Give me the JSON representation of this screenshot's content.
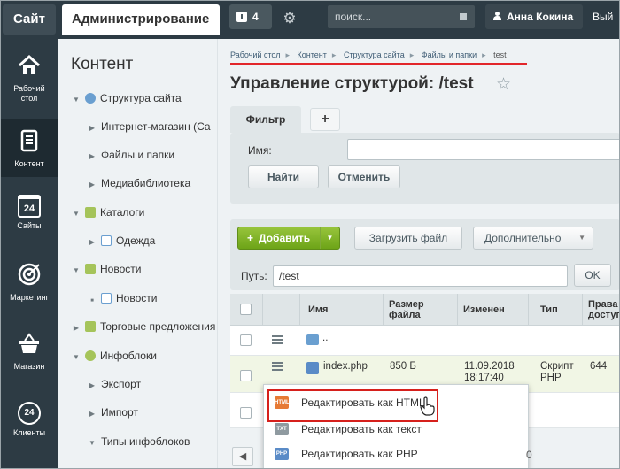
{
  "topbar": {
    "site_label": "Сайт",
    "admin_label": "Администрирование",
    "notif_count": "4",
    "search_placeholder": "поиск...",
    "user_name": "Анна Кокина",
    "exit_label": "Вый"
  },
  "leftnav": {
    "items": [
      {
        "label1": "Рабочий",
        "label2": "стол"
      },
      {
        "label1": "Контент",
        "label2": ""
      },
      {
        "label1": "Сайты",
        "label2": ""
      },
      {
        "label1": "Маркетинг",
        "label2": ""
      },
      {
        "label1": "Магазин",
        "label2": ""
      },
      {
        "label1": "Клиенты",
        "label2": ""
      }
    ],
    "calendar_number": "24",
    "clients_number": "24"
  },
  "tree": {
    "title": "Контент",
    "items": [
      {
        "label": "Структура сайта",
        "arrow": "▼"
      },
      {
        "label": "Интернет-магазин (Са",
        "arrow": "▶"
      },
      {
        "label": "Файлы и папки",
        "arrow": "▶"
      },
      {
        "label": "Медиабиблиотека",
        "arrow": "▶"
      },
      {
        "label": "Каталоги",
        "arrow": "▼"
      },
      {
        "label": "Одежда",
        "arrow": "▶"
      },
      {
        "label": "Новости",
        "arrow": "▼"
      },
      {
        "label": "Новости",
        "arrow": "■"
      },
      {
        "label": "Торговые предложения",
        "arrow": "▶"
      },
      {
        "label": "Инфоблоки",
        "arrow": "▼"
      },
      {
        "label": "Экспорт",
        "arrow": "▶"
      },
      {
        "label": "Импорт",
        "arrow": "▶"
      },
      {
        "label": "Типы инфоблоков",
        "arrow": "▼"
      }
    ]
  },
  "breadcrumb": {
    "items": [
      "Рабочий стол",
      "Контент",
      "Структура сайта",
      "Файлы и папки",
      "test"
    ],
    "separator": "▸"
  },
  "page": {
    "title": "Управление структурой: /test"
  },
  "filter": {
    "tab_label": "Фильтр",
    "add_tab": "+",
    "name_label": "Имя:",
    "find_button": "Найти",
    "cancel_button": "Отменить"
  },
  "toolbar": {
    "add_button": "Добавить",
    "add_dropdown": "▼",
    "upload_button": "Загрузить файл",
    "more_button": "Дополнительно",
    "more_dropdown": "▼",
    "path_label": "Путь:",
    "path_value": "/test",
    "ok_button": "OK"
  },
  "grid": {
    "headers": [
      "Имя",
      "Размер файла",
      "Изменен",
      "Тип",
      "Права на доступ"
    ],
    "rows": [
      {
        "name": "..",
        "size": "",
        "modified": "",
        "type": "",
        "access": ""
      },
      {
        "name": "index.php",
        "size": "850 Б",
        "modified": "11.09.2018 18:17:40",
        "type": "Скрипт PHP",
        "access": "644"
      }
    ]
  },
  "context_menu": {
    "items": [
      {
        "label": "Редактировать как HTML",
        "icon": "HTML"
      },
      {
        "label": "Редактировать как текст",
        "icon": "TXT"
      },
      {
        "label": "Редактировать как PHP",
        "icon": "PHP"
      }
    ]
  },
  "pager": {
    "prev": "◀",
    "tail": "0"
  }
}
